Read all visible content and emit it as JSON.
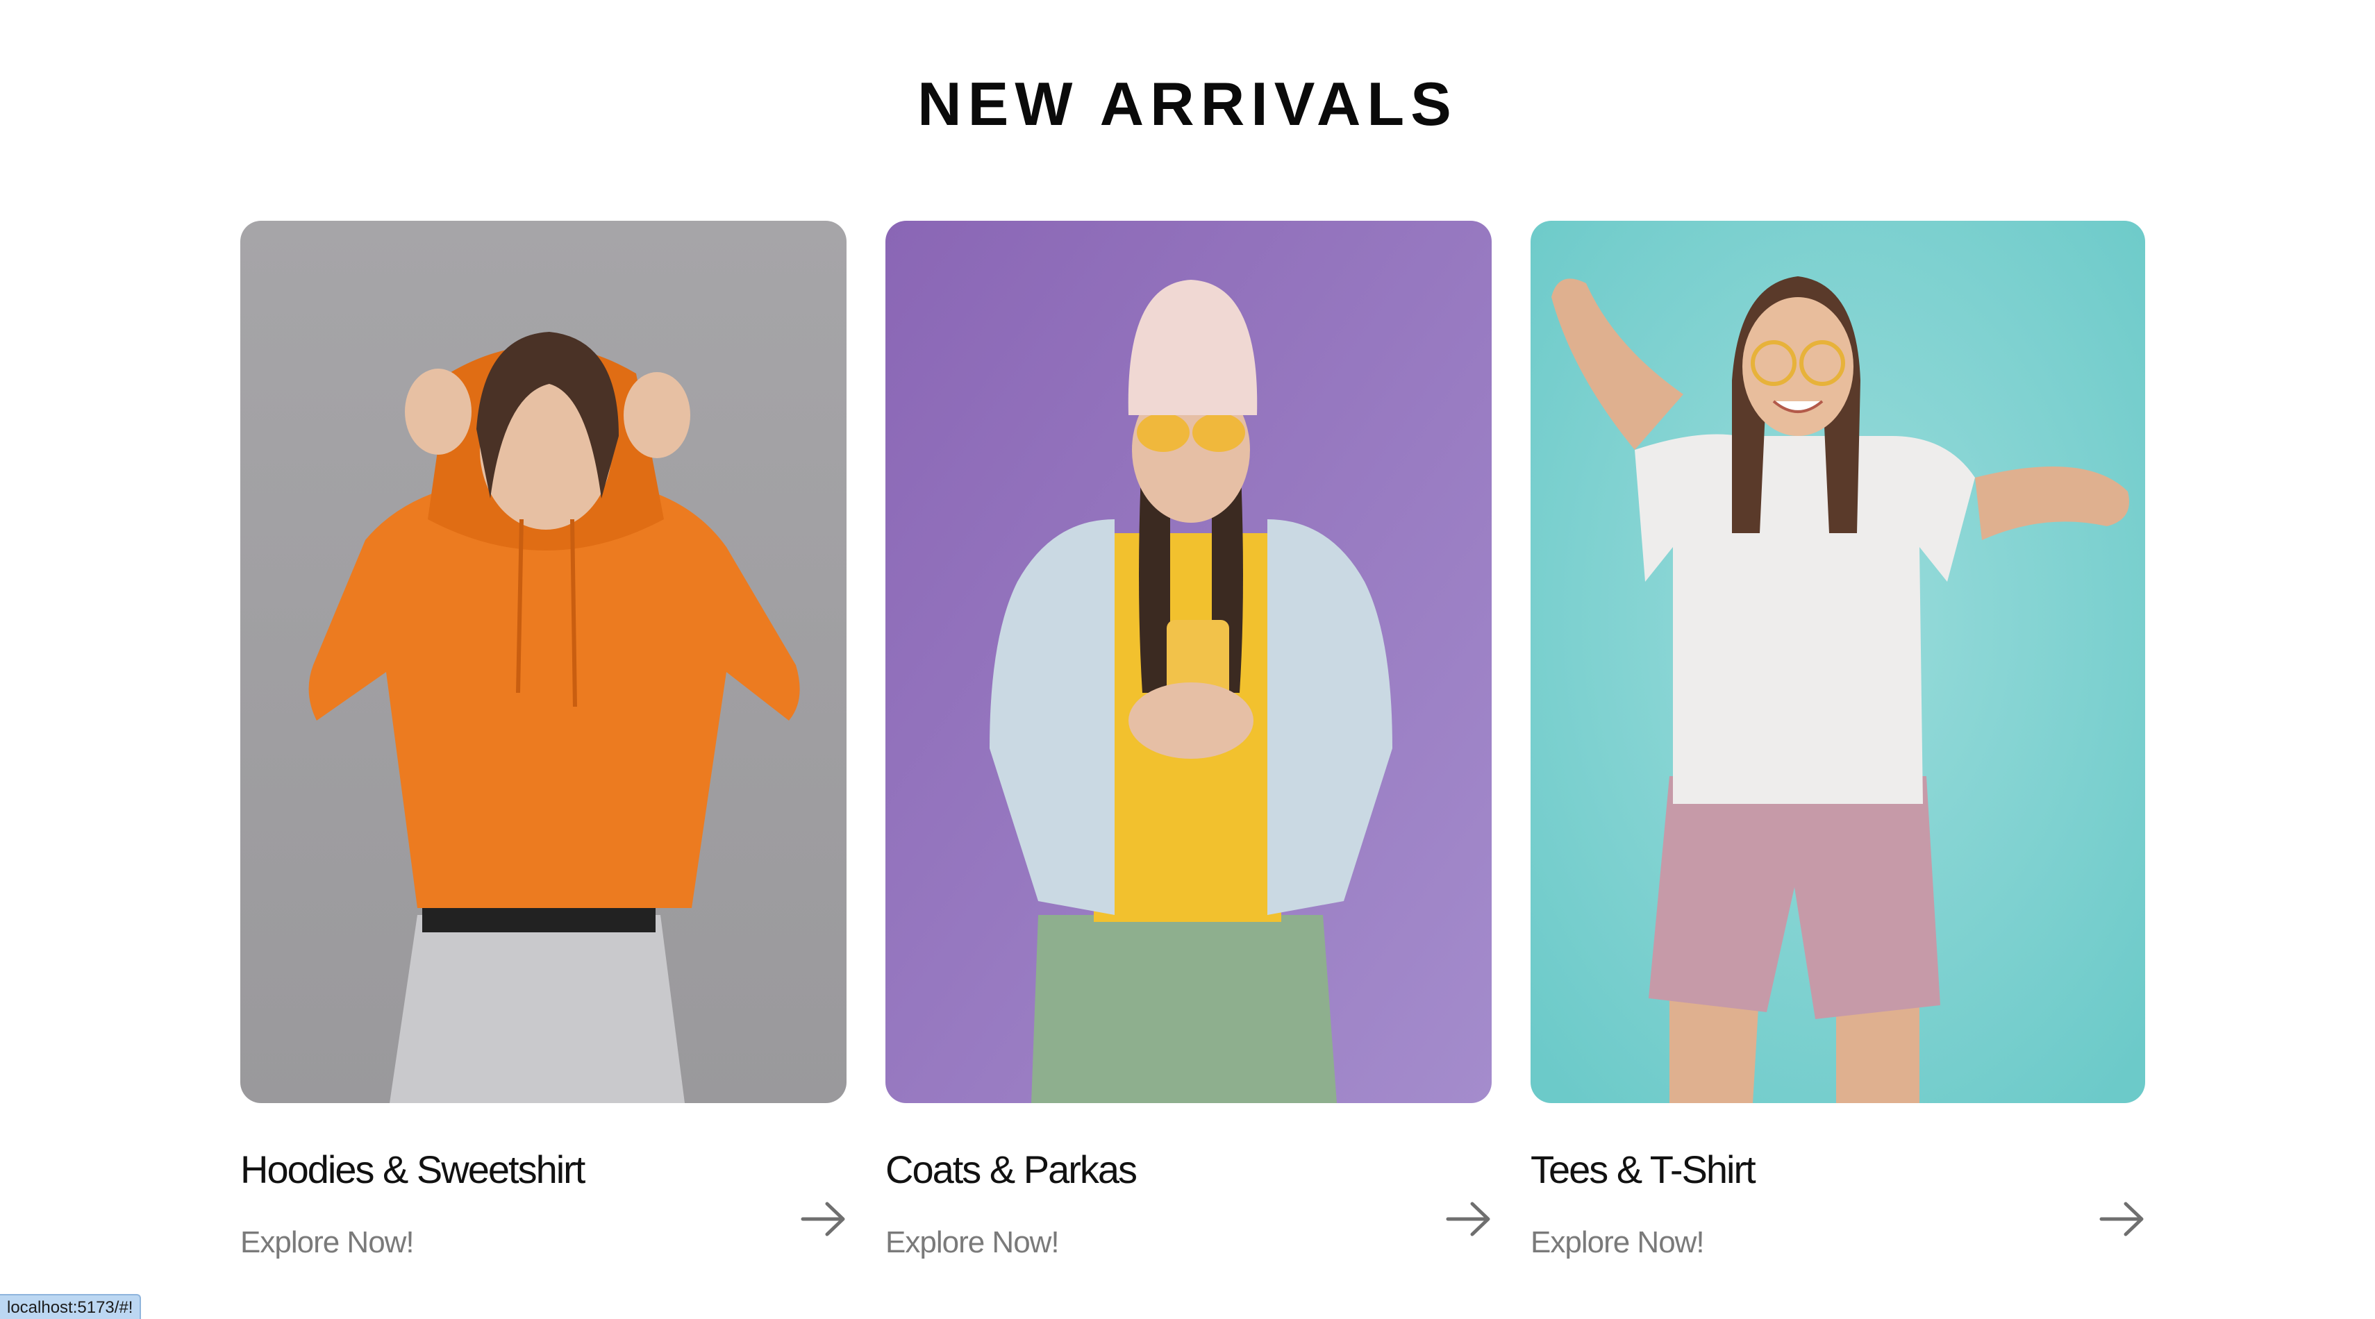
{
  "section": {
    "title": "NEW ARRIVALS"
  },
  "cards": [
    {
      "title": "Hoodies & Sweetshirt",
      "cta": "Explore Now!",
      "image": "woman-orange-hoodie-photo",
      "bg_color": "#a5a4a6",
      "accent_color": "#ee7a1e"
    },
    {
      "title": "Coats & Parkas",
      "cta": "Explore Now!",
      "image": "woman-denim-jacket-photo",
      "bg_color": "#9a7fc0",
      "accent_color": "#cbdbe6"
    },
    {
      "title": "Tees & T-Shirt",
      "cta": "Explore Now!",
      "image": "woman-white-tee-photo",
      "bg_color": "#7fcfce",
      "accent_color": "#f0efee"
    }
  ],
  "icons": {
    "arrow": "arrow-right-icon"
  },
  "status_bar": {
    "url": "localhost:5173/#!"
  }
}
